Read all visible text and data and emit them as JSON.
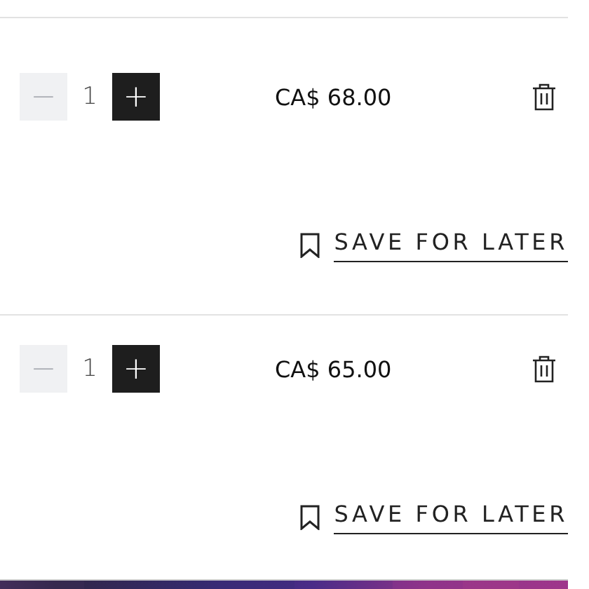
{
  "cart_items": [
    {
      "quantity": "1",
      "decrease": {
        "label": "−",
        "disabled": true
      },
      "increase": {
        "label": "+",
        "disabled": false
      },
      "price": "CA$ 68.00",
      "save_for_later": "SAVE FOR LATER"
    },
    {
      "quantity": "1",
      "decrease": {
        "label": "−",
        "disabled": true
      },
      "increase": {
        "label": "+",
        "disabled": false
      },
      "price": "CA$ 65.00",
      "save_for_later": "SAVE FOR LATER"
    }
  ]
}
